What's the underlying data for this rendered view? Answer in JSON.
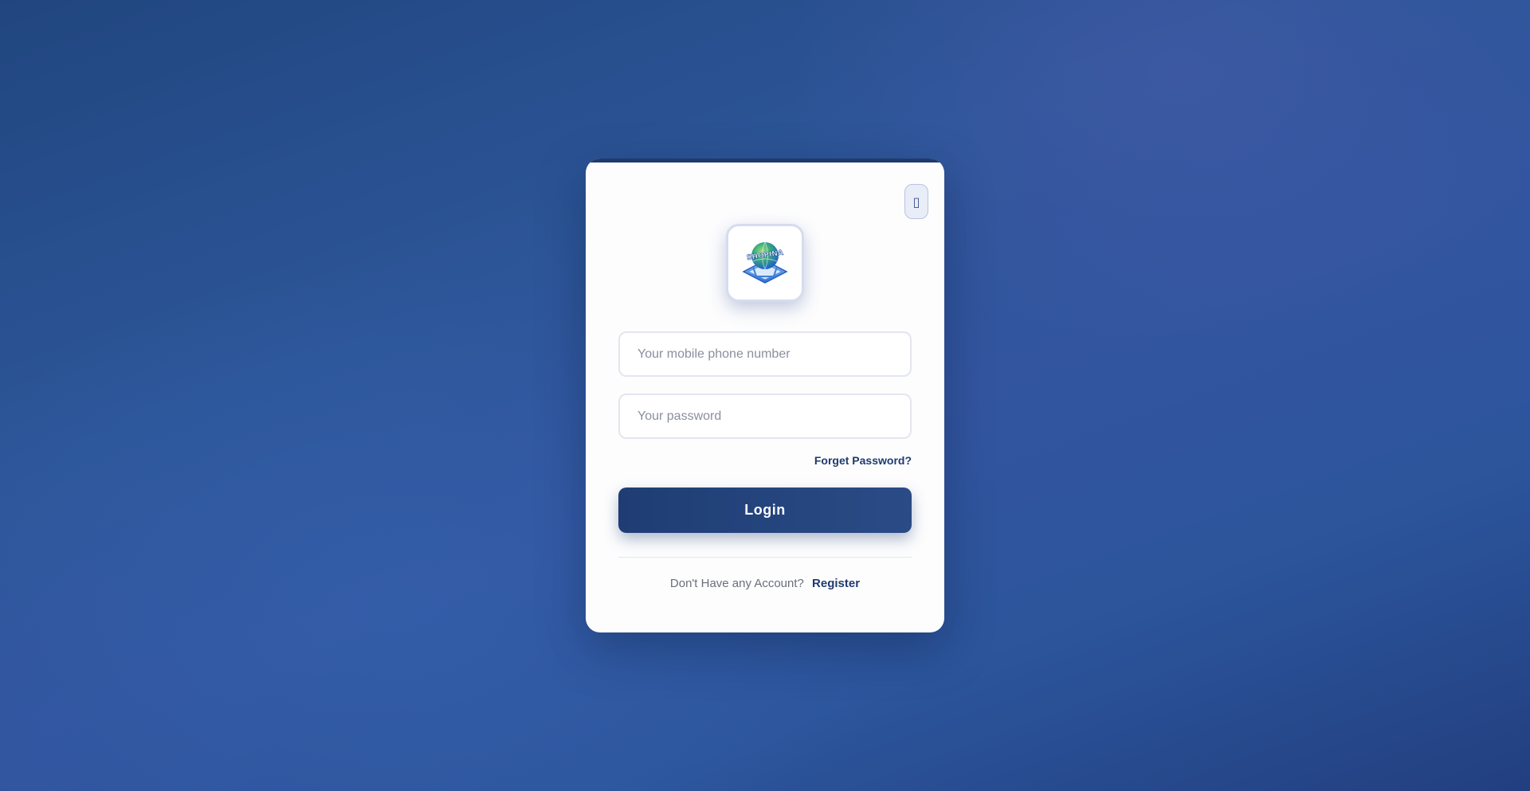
{
  "login_card": {
    "corner_button_glyph": "▯",
    "logo": {
      "icon": "shopping-cart-globe-logo",
      "text": "SHOPINA"
    },
    "phone_field": {
      "value": "",
      "placeholder": "Your mobile phone number"
    },
    "password_field": {
      "value": "",
      "placeholder": "Your password"
    },
    "forgot_label": "Forget Password?",
    "login_label": "Login",
    "register_prompt": "Don't Have any Account?",
    "register_label": "Register"
  },
  "colors": {
    "brand": "#1f3b6e",
    "card_bg": "#fdfdfe",
    "page_bg": "#2d5699"
  }
}
